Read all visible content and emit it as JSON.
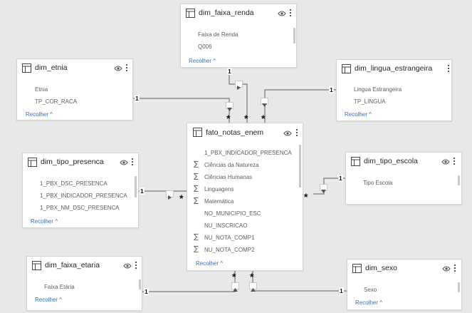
{
  "colors": {
    "background": "#e8e8e8",
    "card": "#ffffff",
    "link": "#3d6fb6",
    "line": "#8a8a8a",
    "text": "#252423",
    "field_text": "#605e5c"
  },
  "icons": {
    "table": "table-icon",
    "visibility": "eye-icon",
    "more": "more-options-icon",
    "sum": "sigma-icon",
    "collapse": "chevron-up-icon",
    "filter_direction": "triangle-icon"
  },
  "cards": {
    "dim_faixa_renda": {
      "title": "dim_faixa_renda",
      "fields": [
        "Faixa de Renda",
        "Q006"
      ],
      "collapse": "Recolher"
    },
    "dim_etnia": {
      "title": "dim_etnia",
      "fields": [
        "Etnia",
        "TP_COR_RACA"
      ],
      "collapse": "Recolher"
    },
    "dim_lingua_estrangeira": {
      "title": "dim_lingua_estrangeira",
      "fields": [
        "Lingua Estrangeira",
        "TP_LINGUA"
      ],
      "collapse": "Recolher"
    },
    "fato_notas_enem": {
      "title": "fato_notas_enem",
      "fields": [
        {
          "label": "1_PBX_INDICADOR_PRESENCA",
          "sum": false
        },
        {
          "label": "Ciências da Natureza",
          "sum": true
        },
        {
          "label": "Ciências Humanas",
          "sum": true
        },
        {
          "label": "Linguagens",
          "sum": true
        },
        {
          "label": "Matemática",
          "sum": true
        },
        {
          "label": "NO_MUNICIPIO_ESC",
          "sum": false
        },
        {
          "label": "NU_INSCRICAO",
          "sum": false
        },
        {
          "label": "NU_NOTA_COMP1",
          "sum": true
        },
        {
          "label": "NU_NOTA_COMP2",
          "sum": true
        }
      ],
      "collapse": "Recolher"
    },
    "dim_tipo_presenca": {
      "title": "dim_tipo_presenca",
      "fields": [
        "1_PBX_DSC_PRESENCA",
        "1_PBX_INDICADOR_PRESENCA",
        "1_PBX_NM_DSC_PRESENCA"
      ],
      "collapse": "Recolher"
    },
    "dim_tipo_escola": {
      "title": "dim_tipo_escola",
      "fields": [
        "Tipo Escola"
      ],
      "collapse": "Recolher"
    },
    "dim_faixa_etaria": {
      "title": "dim_faixa_etaria",
      "fields": [
        "Faixa Etária"
      ],
      "collapse": "Recolher"
    },
    "dim_sexo": {
      "title": "dim_sexo",
      "fields": [
        "Sexo"
      ],
      "collapse": "Recolher"
    }
  },
  "cardinality": {
    "one": "1",
    "many": "*"
  }
}
